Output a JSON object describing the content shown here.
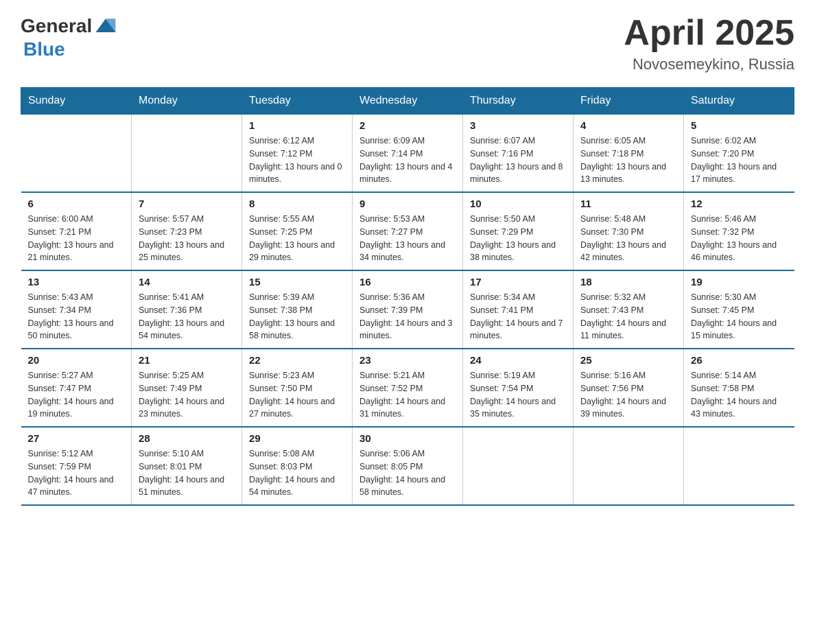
{
  "header": {
    "logo_general": "General",
    "logo_blue": "Blue",
    "title": "April 2025",
    "location": "Novosemeykino, Russia"
  },
  "calendar": {
    "days_of_week": [
      "Sunday",
      "Monday",
      "Tuesday",
      "Wednesday",
      "Thursday",
      "Friday",
      "Saturday"
    ],
    "weeks": [
      [
        {
          "day": "",
          "sunrise": "",
          "sunset": "",
          "daylight": ""
        },
        {
          "day": "",
          "sunrise": "",
          "sunset": "",
          "daylight": ""
        },
        {
          "day": "1",
          "sunrise": "Sunrise: 6:12 AM",
          "sunset": "Sunset: 7:12 PM",
          "daylight": "Daylight: 13 hours and 0 minutes."
        },
        {
          "day": "2",
          "sunrise": "Sunrise: 6:09 AM",
          "sunset": "Sunset: 7:14 PM",
          "daylight": "Daylight: 13 hours and 4 minutes."
        },
        {
          "day": "3",
          "sunrise": "Sunrise: 6:07 AM",
          "sunset": "Sunset: 7:16 PM",
          "daylight": "Daylight: 13 hours and 8 minutes."
        },
        {
          "day": "4",
          "sunrise": "Sunrise: 6:05 AM",
          "sunset": "Sunset: 7:18 PM",
          "daylight": "Daylight: 13 hours and 13 minutes."
        },
        {
          "day": "5",
          "sunrise": "Sunrise: 6:02 AM",
          "sunset": "Sunset: 7:20 PM",
          "daylight": "Daylight: 13 hours and 17 minutes."
        }
      ],
      [
        {
          "day": "6",
          "sunrise": "Sunrise: 6:00 AM",
          "sunset": "Sunset: 7:21 PM",
          "daylight": "Daylight: 13 hours and 21 minutes."
        },
        {
          "day": "7",
          "sunrise": "Sunrise: 5:57 AM",
          "sunset": "Sunset: 7:23 PM",
          "daylight": "Daylight: 13 hours and 25 minutes."
        },
        {
          "day": "8",
          "sunrise": "Sunrise: 5:55 AM",
          "sunset": "Sunset: 7:25 PM",
          "daylight": "Daylight: 13 hours and 29 minutes."
        },
        {
          "day": "9",
          "sunrise": "Sunrise: 5:53 AM",
          "sunset": "Sunset: 7:27 PM",
          "daylight": "Daylight: 13 hours and 34 minutes."
        },
        {
          "day": "10",
          "sunrise": "Sunrise: 5:50 AM",
          "sunset": "Sunset: 7:29 PM",
          "daylight": "Daylight: 13 hours and 38 minutes."
        },
        {
          "day": "11",
          "sunrise": "Sunrise: 5:48 AM",
          "sunset": "Sunset: 7:30 PM",
          "daylight": "Daylight: 13 hours and 42 minutes."
        },
        {
          "day": "12",
          "sunrise": "Sunrise: 5:46 AM",
          "sunset": "Sunset: 7:32 PM",
          "daylight": "Daylight: 13 hours and 46 minutes."
        }
      ],
      [
        {
          "day": "13",
          "sunrise": "Sunrise: 5:43 AM",
          "sunset": "Sunset: 7:34 PM",
          "daylight": "Daylight: 13 hours and 50 minutes."
        },
        {
          "day": "14",
          "sunrise": "Sunrise: 5:41 AM",
          "sunset": "Sunset: 7:36 PM",
          "daylight": "Daylight: 13 hours and 54 minutes."
        },
        {
          "day": "15",
          "sunrise": "Sunrise: 5:39 AM",
          "sunset": "Sunset: 7:38 PM",
          "daylight": "Daylight: 13 hours and 58 minutes."
        },
        {
          "day": "16",
          "sunrise": "Sunrise: 5:36 AM",
          "sunset": "Sunset: 7:39 PM",
          "daylight": "Daylight: 14 hours and 3 minutes."
        },
        {
          "day": "17",
          "sunrise": "Sunrise: 5:34 AM",
          "sunset": "Sunset: 7:41 PM",
          "daylight": "Daylight: 14 hours and 7 minutes."
        },
        {
          "day": "18",
          "sunrise": "Sunrise: 5:32 AM",
          "sunset": "Sunset: 7:43 PM",
          "daylight": "Daylight: 14 hours and 11 minutes."
        },
        {
          "day": "19",
          "sunrise": "Sunrise: 5:30 AM",
          "sunset": "Sunset: 7:45 PM",
          "daylight": "Daylight: 14 hours and 15 minutes."
        }
      ],
      [
        {
          "day": "20",
          "sunrise": "Sunrise: 5:27 AM",
          "sunset": "Sunset: 7:47 PM",
          "daylight": "Daylight: 14 hours and 19 minutes."
        },
        {
          "day": "21",
          "sunrise": "Sunrise: 5:25 AM",
          "sunset": "Sunset: 7:49 PM",
          "daylight": "Daylight: 14 hours and 23 minutes."
        },
        {
          "day": "22",
          "sunrise": "Sunrise: 5:23 AM",
          "sunset": "Sunset: 7:50 PM",
          "daylight": "Daylight: 14 hours and 27 minutes."
        },
        {
          "day": "23",
          "sunrise": "Sunrise: 5:21 AM",
          "sunset": "Sunset: 7:52 PM",
          "daylight": "Daylight: 14 hours and 31 minutes."
        },
        {
          "day": "24",
          "sunrise": "Sunrise: 5:19 AM",
          "sunset": "Sunset: 7:54 PM",
          "daylight": "Daylight: 14 hours and 35 minutes."
        },
        {
          "day": "25",
          "sunrise": "Sunrise: 5:16 AM",
          "sunset": "Sunset: 7:56 PM",
          "daylight": "Daylight: 14 hours and 39 minutes."
        },
        {
          "day": "26",
          "sunrise": "Sunrise: 5:14 AM",
          "sunset": "Sunset: 7:58 PM",
          "daylight": "Daylight: 14 hours and 43 minutes."
        }
      ],
      [
        {
          "day": "27",
          "sunrise": "Sunrise: 5:12 AM",
          "sunset": "Sunset: 7:59 PM",
          "daylight": "Daylight: 14 hours and 47 minutes."
        },
        {
          "day": "28",
          "sunrise": "Sunrise: 5:10 AM",
          "sunset": "Sunset: 8:01 PM",
          "daylight": "Daylight: 14 hours and 51 minutes."
        },
        {
          "day": "29",
          "sunrise": "Sunrise: 5:08 AM",
          "sunset": "Sunset: 8:03 PM",
          "daylight": "Daylight: 14 hours and 54 minutes."
        },
        {
          "day": "30",
          "sunrise": "Sunrise: 5:06 AM",
          "sunset": "Sunset: 8:05 PM",
          "daylight": "Daylight: 14 hours and 58 minutes."
        },
        {
          "day": "",
          "sunrise": "",
          "sunset": "",
          "daylight": ""
        },
        {
          "day": "",
          "sunrise": "",
          "sunset": "",
          "daylight": ""
        },
        {
          "day": "",
          "sunrise": "",
          "sunset": "",
          "daylight": ""
        }
      ]
    ]
  }
}
